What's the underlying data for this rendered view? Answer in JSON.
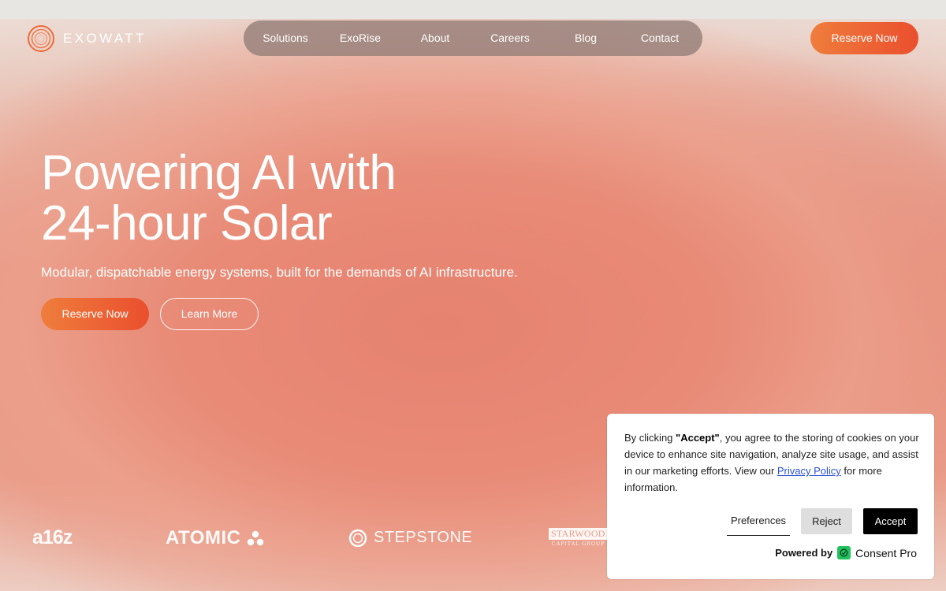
{
  "brand": {
    "name": "EXOWATT",
    "logo_icon": "concentric-circles-icon",
    "accent_start": "#ef7d3c",
    "accent_end": "#ea4f2e"
  },
  "nav": {
    "items": [
      {
        "label": "Solutions"
      },
      {
        "label": "ExoRise"
      },
      {
        "label": "About"
      },
      {
        "label": "Careers"
      },
      {
        "label": "Blog"
      },
      {
        "label": "Contact"
      }
    ],
    "reserve_label": "Reserve Now"
  },
  "hero": {
    "title_line1": "Powering AI with",
    "title_line2": "24-hour Solar",
    "subtitle": "Modular, dispatchable energy systems, built for the demands of AI infrastructure.",
    "primary_button": "Reserve Now",
    "secondary_button": "Learn More"
  },
  "partners": {
    "a16z": "a16z",
    "atomic": "ATOMIC",
    "stepstone": "STEPSTONE",
    "starwood_line1": "STARWOOD",
    "starwood_line2": "CAPITAL GROUP"
  },
  "cookie": {
    "text_before": "By clicking ",
    "text_bold": "\"Accept\"",
    "text_after": ", you agree to the storing of cookies on your device to enhance site navigation, analyze site usage, and assist in our marketing efforts. View our ",
    "privacy_link": "Privacy Policy",
    "text_end": " for more information.",
    "preferences_label": "Preferences",
    "reject_label": "Reject",
    "accept_label": "Accept",
    "powered_by": "Powered by",
    "provider": "Consent Pro",
    "provider_icon": "consent-check-icon",
    "provider_color": "#21c25e"
  }
}
